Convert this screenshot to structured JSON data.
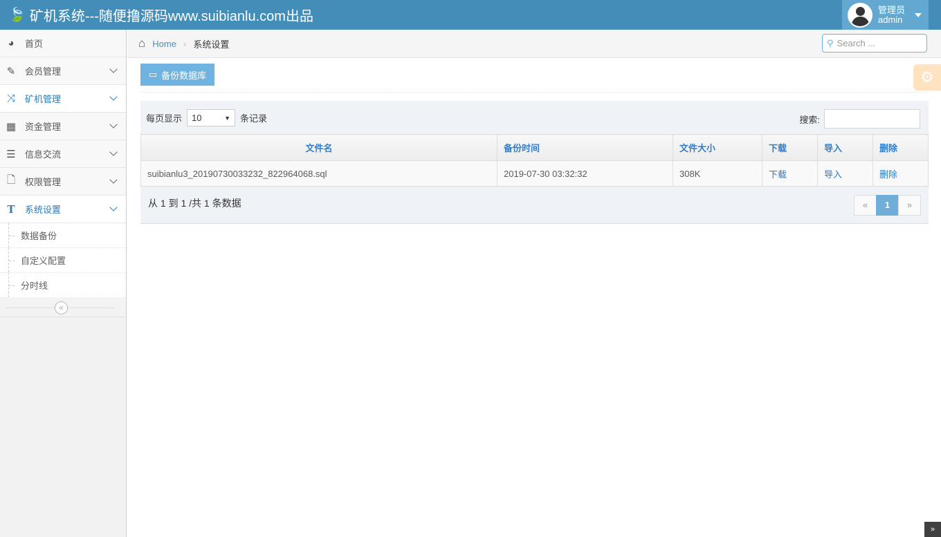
{
  "header": {
    "title": "矿机系统---随便撸源码www.suibianlu.com出品",
    "user_role": "管理员",
    "user_name": "admin"
  },
  "sidebar": {
    "items": [
      {
        "label": "首页",
        "icon": "dashboard-icon"
      },
      {
        "label": "会员管理",
        "icon": "edit-icon"
      },
      {
        "label": "矿机管理",
        "icon": "random-icon"
      },
      {
        "label": "资金管理",
        "icon": "calendar-icon"
      },
      {
        "label": "信息交流",
        "icon": "list-icon"
      },
      {
        "label": "权限管理",
        "icon": "file-icon"
      },
      {
        "label": "系统设置",
        "icon": "text-icon"
      }
    ],
    "subitems": [
      "数据备份",
      "自定义配置",
      "分时线"
    ]
  },
  "breadcrumb": {
    "home": "Home",
    "current": "系统设置"
  },
  "search": {
    "placeholder": "Search ..."
  },
  "toolbar": {
    "backup_label": "备份数据库"
  },
  "table_controls": {
    "show_prefix": "每页显示",
    "page_size": "10",
    "show_suffix": "条记录",
    "filter_label": "搜索:"
  },
  "table": {
    "headers": [
      "文件名",
      "备份时间",
      "文件大小",
      "下载",
      "导入",
      "删除"
    ],
    "rows": [
      {
        "file": "suibianlu3_20190730033232_822964068.sql",
        "time": "2019-07-30 03:32:32",
        "size": "308K",
        "download": "下载",
        "import": "导入",
        "delete": "删除"
      }
    ]
  },
  "footer": {
    "info": "从 1 到 1 /共 1 条数据",
    "prev": "«",
    "page": "1",
    "next": "»"
  }
}
